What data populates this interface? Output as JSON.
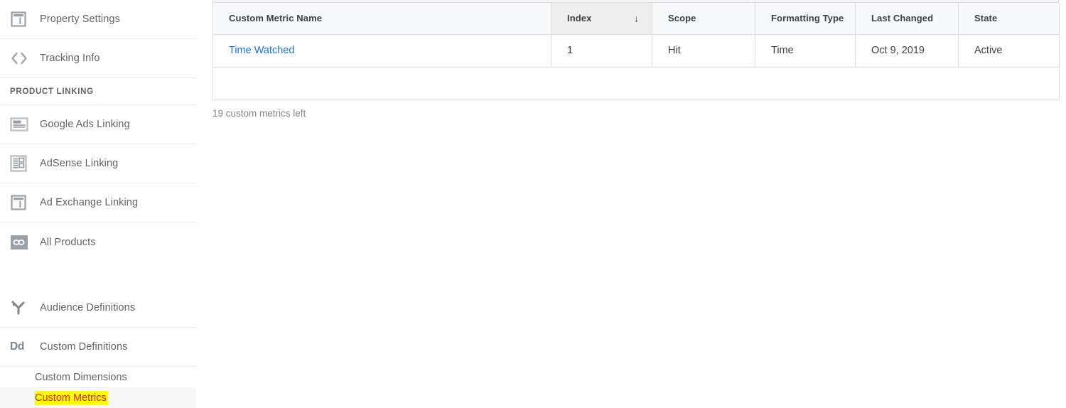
{
  "sidebar": {
    "items": [
      {
        "id": "property-settings",
        "label": "Property Settings",
        "icon": "property-settings-icon"
      },
      {
        "id": "tracking-info",
        "label": "Tracking Info",
        "icon": "code-brackets-icon"
      }
    ],
    "product_linking": {
      "section_label": "PRODUCT LINKING",
      "items": [
        {
          "id": "google-ads-linking",
          "label": "Google Ads Linking",
          "icon": "google-ads-icon"
        },
        {
          "id": "adsense-linking",
          "label": "AdSense Linking",
          "icon": "adsense-icon"
        },
        {
          "id": "ad-exchange-linking",
          "label": "Ad Exchange Linking",
          "icon": "ad-exchange-icon"
        },
        {
          "id": "all-products",
          "label": "All Products",
          "icon": "link-chain-icon"
        }
      ]
    },
    "definitions": [
      {
        "id": "audience-definitions",
        "label": "Audience Definitions",
        "icon": "audience-branch-icon"
      },
      {
        "id": "custom-definitions",
        "label": "Custom Definitions",
        "icon": "dd-icon",
        "icon_text": "Dd"
      }
    ],
    "sub_items": [
      {
        "id": "custom-dimensions",
        "label": "Custom Dimensions",
        "selected": false,
        "highlighted": false
      },
      {
        "id": "custom-metrics",
        "label": "Custom Metrics",
        "selected": true,
        "highlighted": true
      }
    ],
    "highlight_color": "#ffff00",
    "highlight_text_color": "#dd2200"
  },
  "table": {
    "columns": [
      {
        "key": "name",
        "label": "Custom Metric Name",
        "sorted": false
      },
      {
        "key": "index",
        "label": "Index",
        "sorted": true,
        "sort_direction": "desc",
        "sort_glyph": "↓"
      },
      {
        "key": "scope",
        "label": "Scope",
        "sorted": false
      },
      {
        "key": "formatting_type",
        "label": "Formatting Type",
        "sorted": false
      },
      {
        "key": "last_changed",
        "label": "Last Changed",
        "sorted": false
      },
      {
        "key": "state",
        "label": "State",
        "sorted": false
      }
    ],
    "rows": [
      {
        "name": "Time Watched",
        "index": "1",
        "scope": "Hit",
        "formatting_type": "Time",
        "last_changed": "Oct 9, 2019",
        "state": "Active",
        "name_is_link": true
      }
    ],
    "link_color": "#1a73e8"
  },
  "footer": {
    "metrics_left": "19 custom metrics left"
  }
}
